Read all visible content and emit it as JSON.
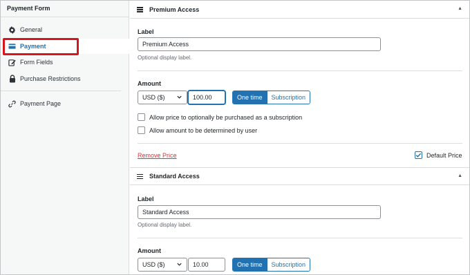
{
  "sidebar": {
    "title": "Payment Form",
    "items": [
      {
        "label": "General",
        "icon": "gear-icon"
      },
      {
        "label": "Payment",
        "icon": "credit-card-icon"
      },
      {
        "label": "Form Fields",
        "icon": "edit-icon"
      },
      {
        "label": "Purchase Restrictions",
        "icon": "lock-icon"
      },
      {
        "label": "Payment Page",
        "icon": "link-icon"
      }
    ],
    "active": "Payment"
  },
  "prices": [
    {
      "title": "Premium Access",
      "label_heading": "Label",
      "label_value": "Premium Access",
      "label_help": "Optional display label.",
      "amount_heading": "Amount",
      "currency": "USD ($)",
      "amount": "100.00",
      "type_options": [
        "One time",
        "Subscription"
      ],
      "type_selected": "One time",
      "opt_subscription": "Allow price to optionally be purchased as a subscription",
      "opt_user_amount": "Allow amount to be determined by user",
      "remove_label": "Remove Price",
      "default_label": "Default Price",
      "is_default": true
    },
    {
      "title": "Standard Access",
      "label_heading": "Label",
      "label_value": "Standard Access",
      "label_help": "Optional display label.",
      "amount_heading": "Amount",
      "currency": "USD ($)",
      "amount": "10.00",
      "type_options": [
        "One time",
        "Subscription"
      ],
      "type_selected": "One time"
    }
  ],
  "colors": {
    "accent": "#2271b1",
    "highlight": "#d6161b",
    "danger": "#d63638"
  }
}
